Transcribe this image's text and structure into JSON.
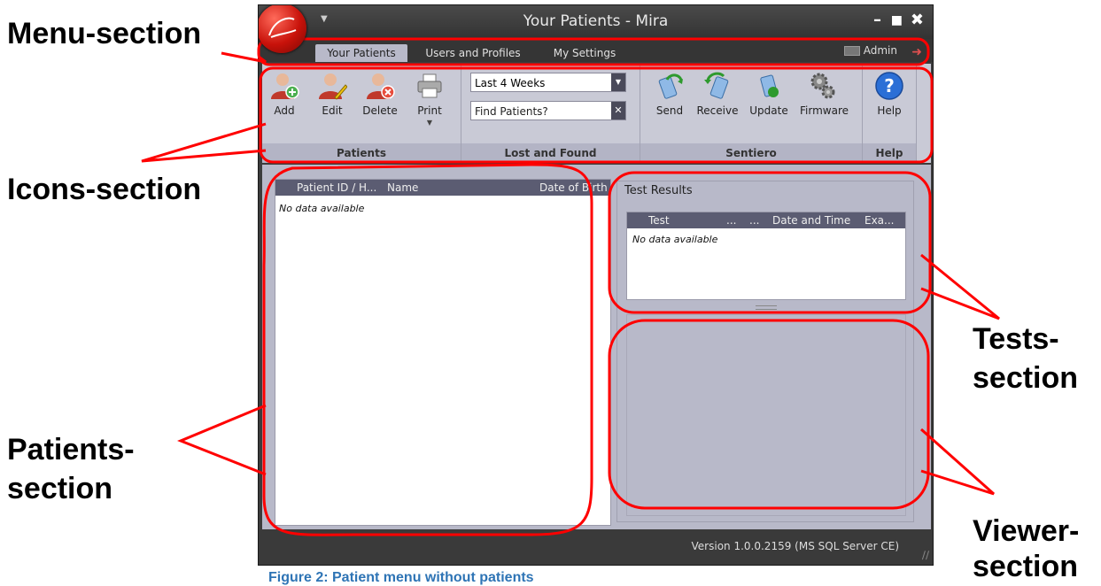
{
  "annotations": {
    "menu": "Menu-section",
    "icons": "Icons-section",
    "patients_1": "Patients-",
    "patients_2": "section",
    "tests_1": "Tests-",
    "tests_2": "section",
    "viewer_1": "Viewer-",
    "viewer_2": "section"
  },
  "caption": "Figure 2: Patient menu without patients",
  "window": {
    "title": "Your Patients - Mira",
    "minimize": "–",
    "maximize": "■",
    "close": "✖"
  },
  "tabs": [
    {
      "label": "Your Patients"
    },
    {
      "label": "Users and Profiles"
    },
    {
      "label": "My Settings"
    }
  ],
  "user": {
    "name": "Admin"
  },
  "ribbon": {
    "patients": {
      "title": "Patients",
      "buttons": [
        {
          "label": "Add",
          "icon": "user-add-icon"
        },
        {
          "label": "Edit",
          "icon": "user-edit-icon"
        },
        {
          "label": "Delete",
          "icon": "user-delete-icon"
        },
        {
          "label": "Print",
          "icon": "printer-icon"
        }
      ]
    },
    "lost_found": {
      "title": "Lost and Found",
      "period": "Last 4 Weeks",
      "search_value": "Find Patients?"
    },
    "sentiero": {
      "title": "Sentiero",
      "buttons": [
        {
          "label": "Send",
          "icon": "send-icon"
        },
        {
          "label": "Receive",
          "icon": "receive-icon"
        },
        {
          "label": "Update",
          "icon": "update-icon"
        },
        {
          "label": "Firmware",
          "icon": "gears-icon"
        }
      ]
    },
    "help": {
      "title": "Help",
      "button": "Help"
    }
  },
  "patients_grid": {
    "columns": [
      "Patient ID / H...",
      "Name",
      "Date of Birth"
    ],
    "empty": "No data available"
  },
  "tests": {
    "title": "Test Results",
    "columns": [
      "Test",
      "...",
      "...",
      "Date and Time",
      "Exa..."
    ],
    "empty": "No data available"
  },
  "status": {
    "version": "Version 1.0.0.2159 (MS SQL Server CE)"
  }
}
